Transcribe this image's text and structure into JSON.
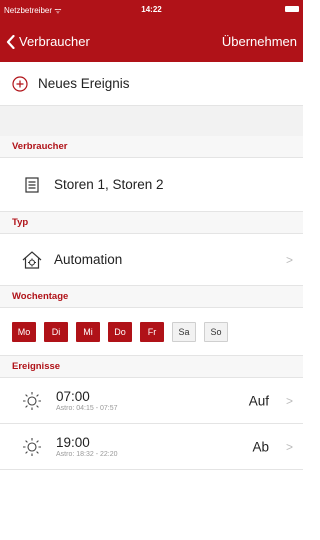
{
  "status_bar": {
    "carrier": "Netzbetreiber ᯤ",
    "time": "14:22"
  },
  "nav": {
    "back_label": "Verbraucher",
    "apply_label": "Übernehmen"
  },
  "new_event": {
    "label": "Neues Ereignis"
  },
  "sections": {
    "consumer": {
      "header": "Verbraucher",
      "value": "Storen 1, Storen 2",
      "icon": "list-icon"
    },
    "type": {
      "header": "Typ",
      "value": "Automation",
      "icon": "home-gear-icon"
    },
    "weekdays": {
      "header": "Wochentage",
      "days": [
        {
          "label": "Mo",
          "active": true
        },
        {
          "label": "Di",
          "active": true
        },
        {
          "label": "Mi",
          "active": true
        },
        {
          "label": "Do",
          "active": true
        },
        {
          "label": "Fr",
          "active": true
        },
        {
          "label": "Sa",
          "active": false
        },
        {
          "label": "So",
          "active": false
        }
      ]
    },
    "events": {
      "header": "Ereignisse",
      "items": [
        {
          "time": "07:00",
          "astro": "Astro: 04:15 - 07:57",
          "action": "Auf",
          "icon": "sun-icon"
        },
        {
          "time": "19:00",
          "astro": "Astro: 18:32 - 22:20",
          "action": "Ab",
          "icon": "sun-icon"
        }
      ]
    }
  },
  "colors": {
    "accent": "#b01218",
    "section_bg": "#f7f7f7",
    "inactive_day": "#f2f2f2"
  }
}
